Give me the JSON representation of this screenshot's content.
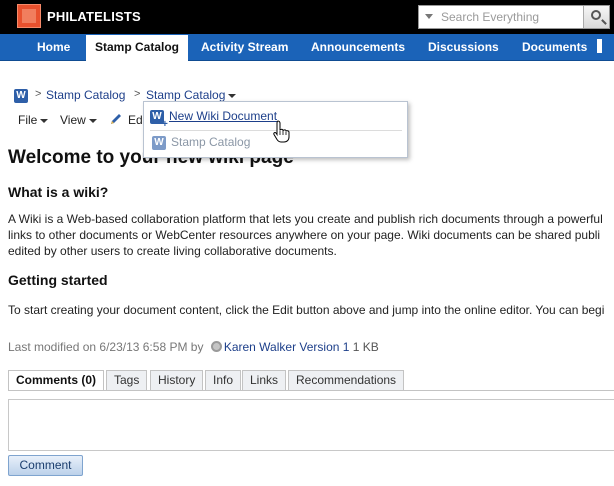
{
  "app": {
    "brand": "PHILATELISTS"
  },
  "search": {
    "placeholder": "Search Everything"
  },
  "nav": [
    "Home",
    "Stamp Catalog",
    "Activity Stream",
    "Announcements",
    "Discussions",
    "Documents"
  ],
  "breadcrumb": {
    "items": [
      "Stamp Catalog",
      "Stamp Catalog"
    ],
    "separator": ">"
  },
  "toolbar": {
    "file": "File",
    "view": "View",
    "edit": "Ed"
  },
  "dropdown": {
    "new_doc": "New Wiki Document",
    "current": "Stamp Catalog"
  },
  "page": {
    "title": "Welcome to your new wiki page",
    "h_what": "What is a wiki?",
    "p1": "A Wiki is a Web-based collaboration platform that lets you create and publish rich documents through a powerful",
    "p2": "links to other documents or WebCenter resources anywhere on your page. Wiki documents can be shared publi",
    "p3": "edited by other users to create living collaborative documents.",
    "h_start": "Getting started",
    "p4": "To start creating your document content, click the Edit button above and jump into the online editor. You can begi"
  },
  "meta": {
    "modified": "Last modified on 6/23/13 6:58 PM  by",
    "user": "Karen Walker",
    "version": "Version 1",
    "size": "1 KB"
  },
  "tabs": [
    "Comments (0)",
    "Tags",
    "History",
    "Info",
    "Links",
    "Recommendations"
  ],
  "comment_button": "Comment",
  "colors": {
    "nav": "#1b63b8",
    "link": "#1d3f8a",
    "logo": "#e8512e"
  }
}
